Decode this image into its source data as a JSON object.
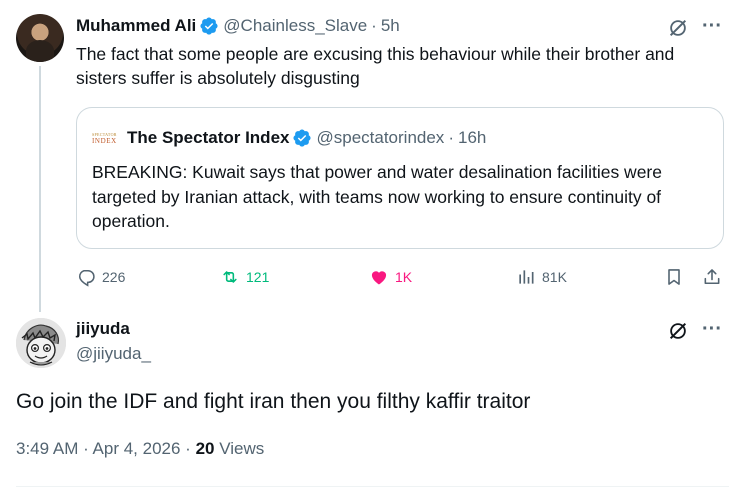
{
  "main_tweet": {
    "author_name": "Muhammed Ali",
    "handle": "@Chainless_Slave",
    "separator": "·",
    "time": "5h",
    "text": "The fact that some people are excusing this behaviour while their brother and sisters suffer is absolutely disgusting",
    "quoted": {
      "logo_line1": "SPECTATOR",
      "logo_line2": "INDEX",
      "author_name": "The Spectator Index",
      "handle": "@spectatorindex",
      "separator": "·",
      "time": "16h",
      "text": "BREAKING: Kuwait says that power and water desalination facilities were targeted by Iranian attack, with teams now working to ensure continuity of operation."
    },
    "actions": {
      "replies": "226",
      "reposts": "121",
      "likes": "1K",
      "views": "81K"
    }
  },
  "reply_tweet": {
    "author_name": "jiiyuda",
    "handle": "@jiiyuda_",
    "text": "Go join the IDF and fight iran then you filthy kaffir traitor",
    "timestamp": "3:49 AM · Apr 4, 2026 ·",
    "views_count": "20",
    "views_label": "Views"
  },
  "colors": {
    "verified": "#1d9bf0",
    "repost_active": "#00ba7c",
    "like_active": "#f91880",
    "secondary_text": "#536471"
  },
  "icons": [
    "verified-badge-icon",
    "grok-icon",
    "more-icon",
    "reply-icon",
    "repost-icon",
    "like-icon",
    "views-icon",
    "bookmark-icon",
    "share-icon"
  ]
}
